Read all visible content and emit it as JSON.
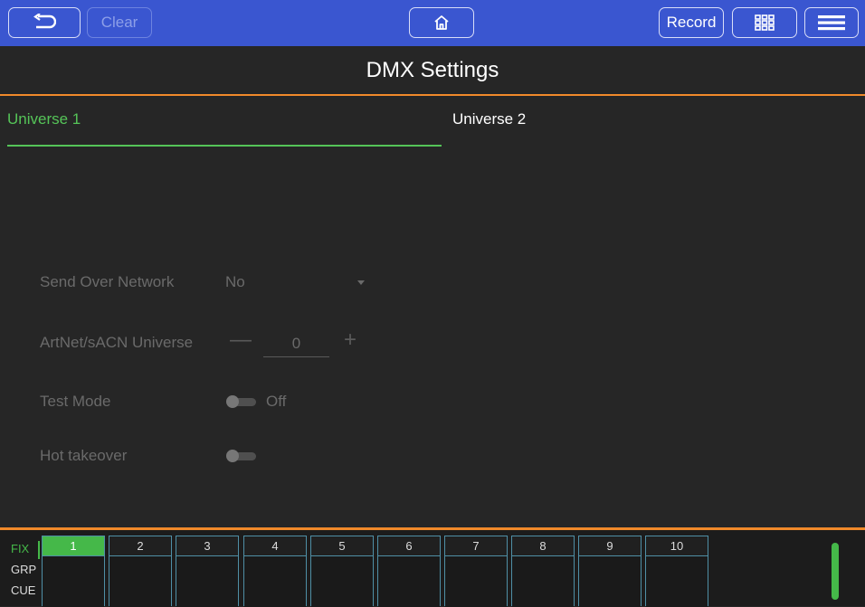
{
  "topbar": {
    "clear_label": "Clear",
    "record_label": "Record"
  },
  "page_title": "DMX Settings",
  "tabs": [
    {
      "label": "Universe 1",
      "active": true
    },
    {
      "label": "Universe 2",
      "active": false
    }
  ],
  "settings": {
    "send_over_network": {
      "label": "Send Over Network",
      "value": "No"
    },
    "artnet_universe": {
      "label": "ArtNet/sACN Universe",
      "value": "0",
      "minus": "—",
      "plus": "+"
    },
    "test_mode": {
      "label": "Test Mode",
      "state": "Off"
    },
    "hot_takeover": {
      "label": "Hot takeover"
    }
  },
  "bottom_bar": {
    "modes": [
      "FIX",
      "GRP",
      "CUE"
    ],
    "slots": [
      "1",
      "2",
      "3",
      "4",
      "5",
      "6",
      "7",
      "8",
      "9",
      "10"
    ],
    "active_slot": "1"
  },
  "colors": {
    "topbar": "#3a56d0",
    "accent_orange": "#f0892a",
    "accent_green": "#45b849",
    "background": "#262626"
  }
}
